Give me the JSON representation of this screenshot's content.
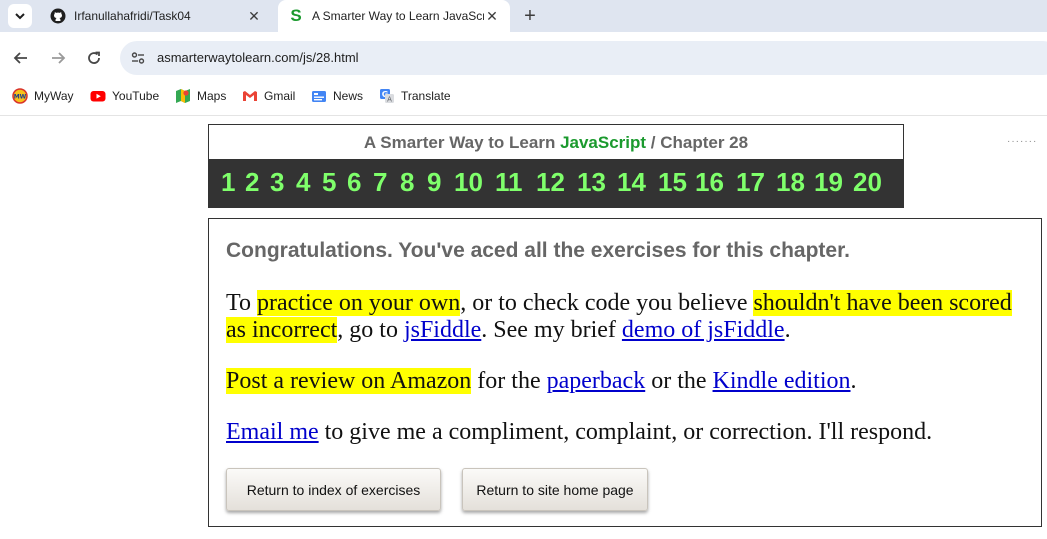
{
  "browser": {
    "tabs": [
      {
        "title": "Irfanullahafridi/Task04",
        "icon": "github-icon"
      },
      {
        "title": "A Smarter Way to Learn JavaScr",
        "icon": "s-logo-icon"
      }
    ],
    "address_url": "asmarterwaytolearn.com/js/28.html",
    "bookmarks": [
      {
        "label": "MyWay",
        "icon": "myway-icon"
      },
      {
        "label": "YouTube",
        "icon": "youtube-icon"
      },
      {
        "label": "Maps",
        "icon": "maps-icon"
      },
      {
        "label": "Gmail",
        "icon": "gmail-icon"
      },
      {
        "label": "News",
        "icon": "news-icon"
      },
      {
        "label": "Translate",
        "icon": "translate-icon"
      }
    ]
  },
  "header": {
    "title_prefix": "A Smarter Way to Learn ",
    "title_brand": "JavaScript",
    "title_suffix": " / Chapter 28",
    "brand_color": "#1b9a2e",
    "chapter_numbers": [
      "1",
      "2",
      "3",
      "4",
      "5",
      "6",
      "7",
      "8",
      "9",
      "10",
      "11",
      "12",
      "13",
      "14",
      "15",
      "16",
      "17",
      "18",
      "19",
      "20"
    ]
  },
  "main": {
    "congrats": "Congratulations. You've aced all the exercises for this chapter.",
    "p1": {
      "t1": "To ",
      "h1": "practice on your own",
      "t2": ", or to check code you believe ",
      "h2": "shouldn't have been scored as incorrect",
      "t3": ", go to ",
      "l1": "jsFiddle",
      "t4": ". See my brief ",
      "l2": "demo of jsFiddle",
      "t5": "."
    },
    "p2": {
      "h1": "Post a review on Amazon",
      "t1": " for the ",
      "l1": "paperback",
      "t2": " or the ",
      "l2": "Kindle edition",
      "t3": "."
    },
    "p3": {
      "l1": "Email me",
      "t1": " to give me a compliment, complaint, or correction. I'll respond."
    },
    "buttons": {
      "index": "Return to index of exercises",
      "home": "Return to site home page"
    },
    "highlight_color": "#ffff00",
    "link_color": "#0000cc"
  }
}
